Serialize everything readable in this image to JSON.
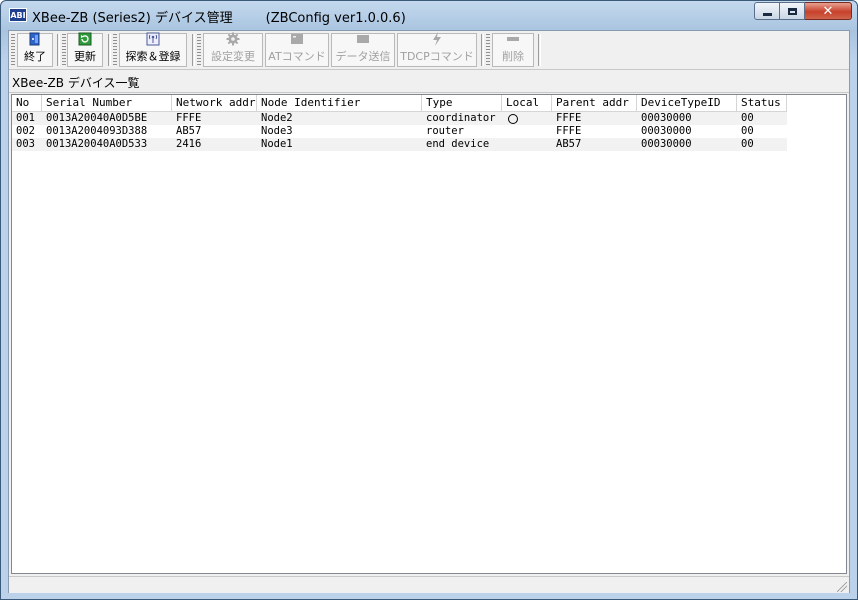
{
  "window": {
    "title": "XBee-ZB (Series2) デバイス管理        (ZBConfig ver1.0.0.6)",
    "app_icon_text": "ABI",
    "close_glyph": "✕"
  },
  "toolbar": {
    "exit_label": "終了",
    "refresh_label": "更新",
    "search_register_label": "探索＆登録",
    "settings_label": "設定変更",
    "at_command_label": "ATコマンド",
    "send_data_label": "データ送信",
    "tdcp_command_label": "TDCPコマンド",
    "delete_label": "削除"
  },
  "group_label": "XBee-ZB デバイス一覧",
  "table": {
    "columns": [
      "No",
      "Serial Number",
      "Network addr",
      "Node Identifier",
      "Type",
      "Local",
      "Parent addr",
      "DeviceTypeID",
      "Status"
    ],
    "rows": [
      {
        "no": "001",
        "serial": "0013A20040A0D5BE",
        "network": "FFFE",
        "node_id": "Node2",
        "type": "coordinator",
        "local": true,
        "parent": "FFFE",
        "device_type_id": "00030000",
        "status": "00"
      },
      {
        "no": "002",
        "serial": "0013A2004093D388",
        "network": "AB57",
        "node_id": "Node3",
        "type": "router",
        "local": false,
        "parent": "FFFE",
        "device_type_id": "00030000",
        "status": "00"
      },
      {
        "no": "003",
        "serial": "0013A20040A0D533",
        "network": "2416",
        "node_id": "Node1",
        "type": "end device",
        "local": false,
        "parent": "AB57",
        "device_type_id": "00030000",
        "status": "00"
      }
    ]
  }
}
